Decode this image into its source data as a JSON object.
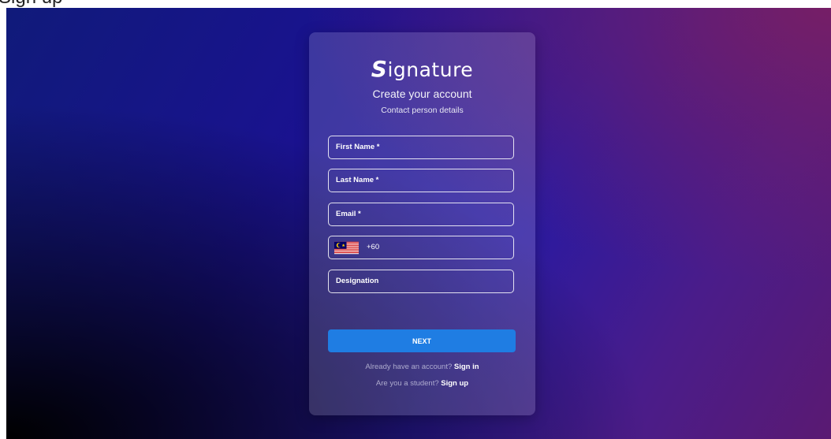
{
  "top_strip": {
    "text": "Sign up"
  },
  "brand": {
    "mark": "S",
    "rest": "ignature"
  },
  "header": {
    "title": "Create your account",
    "subtitle": "Contact person details"
  },
  "form": {
    "first_name_label": "First Name *",
    "last_name_label": "Last Name *",
    "email_label": "Email *",
    "phone_code": "+60",
    "phone_flag": "malaysia-flag-icon",
    "designation_label": "Designation"
  },
  "actions": {
    "next_label": "NEXT"
  },
  "footer": {
    "signin_prompt": "Already have an account?",
    "signin_link": "Sign in",
    "student_prompt": "Are you a student?",
    "student_link": "Sign up"
  },
  "colors": {
    "accent_button": "#1f7de3",
    "background_start": "#101a7a",
    "background_end": "#5a1a72"
  }
}
